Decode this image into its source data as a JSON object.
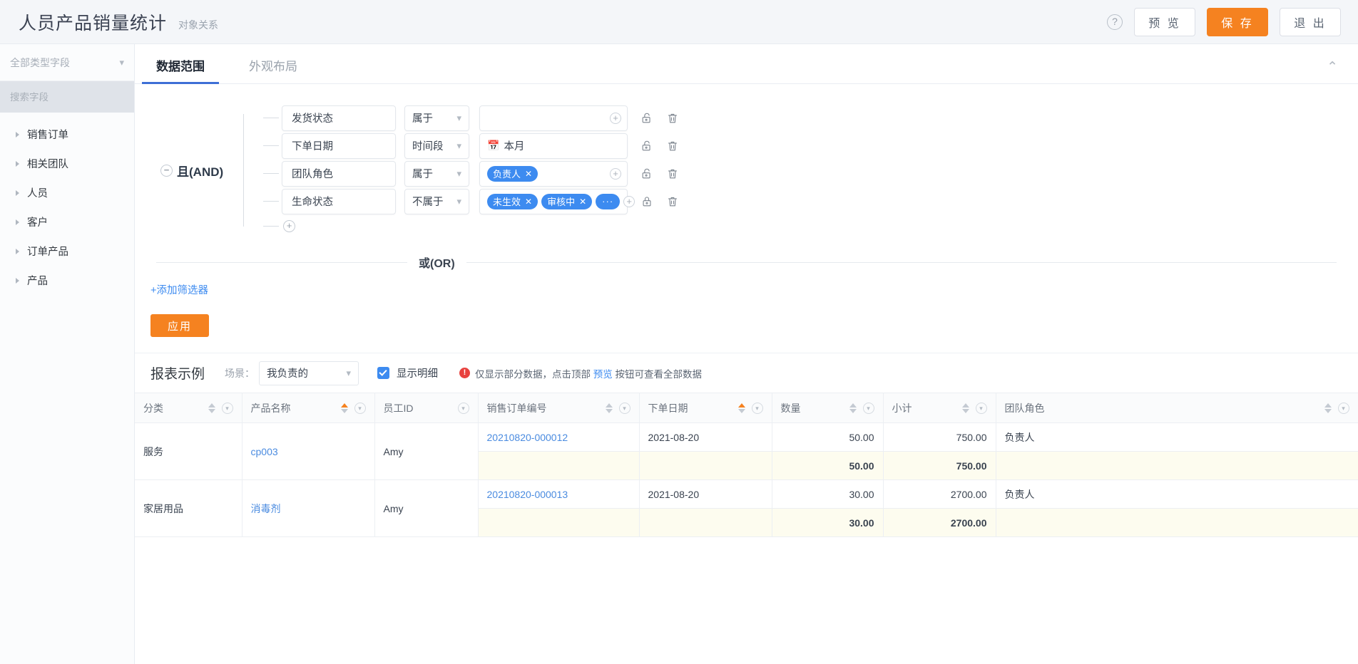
{
  "topbar": {
    "title": "人员产品销量统计",
    "subtitle": "对象关系",
    "help_icon": "question-circle-icon",
    "preview_label": "预 览",
    "save_label": "保 存",
    "exit_label": "退 出",
    "accent_orange": "#f58220"
  },
  "sidebar": {
    "type_select_label": "全部类型字段",
    "search_placeholder": "搜索字段",
    "tree_items": [
      {
        "label": "销售订单"
      },
      {
        "label": "相关团队"
      },
      {
        "label": "人员"
      },
      {
        "label": "客户"
      },
      {
        "label": "订单产品"
      },
      {
        "label": "产品"
      }
    ]
  },
  "tabs": [
    {
      "label": "数据范围",
      "active": true
    },
    {
      "label": "外观布局",
      "active": false
    }
  ],
  "collapse_icon": "chevron-double-up-icon",
  "filter": {
    "group_operator": "且(AND)",
    "rows": [
      {
        "field": "发货状态",
        "operator": "属于",
        "value_tags": [],
        "date_value": "",
        "locked": false
      },
      {
        "field": "下单日期",
        "operator": "时间段",
        "value_tags": [],
        "date_value": "本月",
        "locked": false
      },
      {
        "field": "团队角色",
        "operator": "属于",
        "value_tags": [
          "负责人"
        ],
        "date_value": "",
        "locked": false
      },
      {
        "field": "生命状态",
        "operator": "不属于",
        "value_tags": [
          "未生效",
          "审核中",
          "···"
        ],
        "date_value": "",
        "locked": true
      }
    ],
    "or_label": "或(OR)",
    "add_filter_label": "+添加筛选器",
    "apply_label": "应用"
  },
  "report": {
    "title": "报表示例",
    "scene_label": "场景：",
    "scene_value": "我负责的",
    "detail_checkbox_label": "显示明细",
    "detail_checked": true,
    "warning_prefix": "仅显示部分数据，点击顶部",
    "warning_link": "预览",
    "warning_suffix": "按钮可查看全部数据"
  },
  "table": {
    "columns": [
      {
        "label": "分类",
        "sortable": true,
        "sort": "none",
        "filter": true,
        "align": "left"
      },
      {
        "label": "产品名称",
        "sortable": true,
        "sort": "asc",
        "filter": true,
        "align": "left"
      },
      {
        "label": "员工ID",
        "sortable": false,
        "sort": "none",
        "filter": true,
        "align": "left"
      },
      {
        "label": "销售订单编号",
        "sortable": true,
        "sort": "none",
        "filter": true,
        "align": "left"
      },
      {
        "label": "下单日期",
        "sortable": true,
        "sort": "asc",
        "filter": true,
        "align": "left"
      },
      {
        "label": "数量",
        "sortable": true,
        "sort": "none",
        "filter": true,
        "align": "left"
      },
      {
        "label": "小计",
        "sortable": true,
        "sort": "none",
        "filter": true,
        "align": "left"
      },
      {
        "label": "团队角色",
        "sortable": true,
        "sort": "none",
        "filter": true,
        "align": "left"
      }
    ],
    "groups": [
      {
        "category": "服务",
        "product": "cp003",
        "employee": "Amy",
        "detail": {
          "order_no": "20210820-000012",
          "order_date": "2021-08-20",
          "qty": "50.00",
          "subtotal": "750.00",
          "team_role": "负责人"
        },
        "summary": {
          "qty": "50.00",
          "subtotal": "750.00"
        }
      },
      {
        "category": "家居用品",
        "product": "消毒剂",
        "employee": "Amy",
        "detail": {
          "order_no": "20210820-000013",
          "order_date": "2021-08-20",
          "qty": "30.00",
          "subtotal": "2700.00",
          "team_role": "负责人"
        },
        "summary": {
          "qty": "30.00",
          "subtotal": "2700.00"
        }
      }
    ]
  }
}
